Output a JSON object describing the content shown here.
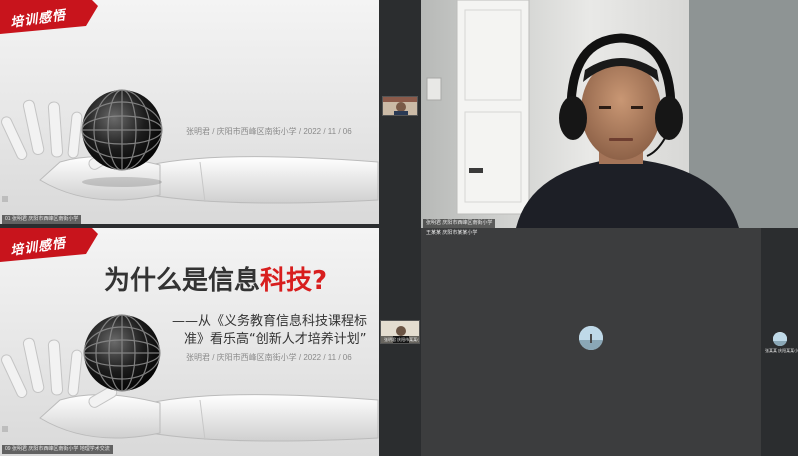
{
  "slide_top": {
    "ribbon_text": "培训感悟",
    "byline": "张明君 / 庆阳市西峰区南街小学 / 2022 / 11 / 06"
  },
  "slide_bottom": {
    "ribbon_text": "培训感悟",
    "title_plain": "为什么是信息",
    "title_red": "科技?",
    "subtitle_line1": "——从《义务教育信息科技课程标",
    "subtitle_line2": "准》看乐高“创新人才培养计划”",
    "byline": "张明君 / 庆阳市西峰区南街小学 / 2022 / 11 / 06"
  },
  "labels": {
    "top_slide_name": "01 张明君 庆阳市西峰区南街小学",
    "bottom_slide_name": "09 张明君 庆阳市西峰区南街小学 地理学术交流",
    "webcam_name": "张明君 庆阳市西峰区南街小学",
    "dark_tile_name": "王某某 庆阳市某某小学",
    "right_thumb_name": "张某某 庆阳某某小学",
    "mid_thumb_name": "张明君 庆阳市某某小学"
  },
  "colors": {
    "ribbon_red": "#c8141c",
    "title_red": "#d81e1e",
    "dark_tile": "#3c3d3e",
    "background": "#2b2d2f"
  }
}
